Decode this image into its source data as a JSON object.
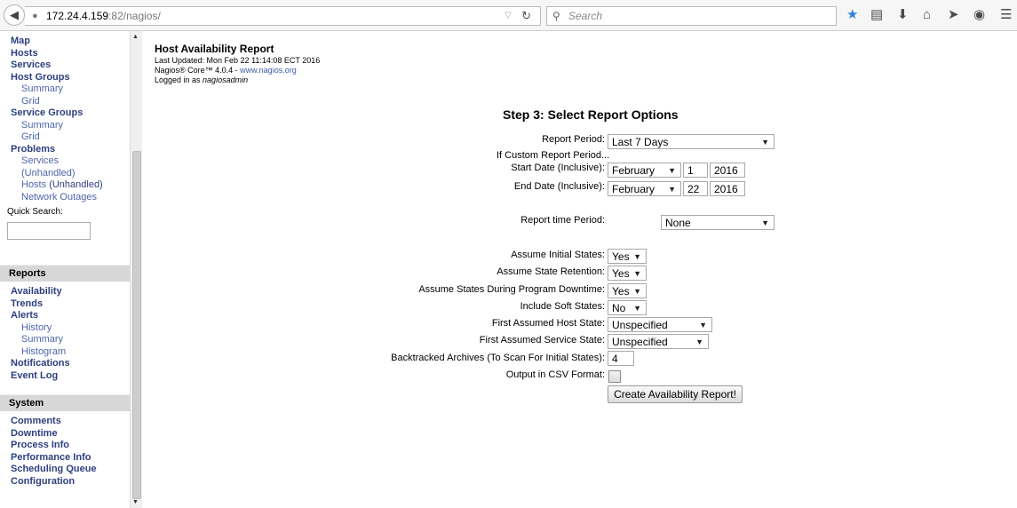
{
  "browser": {
    "url_host": "172.24.4.159",
    "url_rest": ":82/nagios/",
    "search_placeholder": "Search"
  },
  "sidebar": {
    "top_items": [
      {
        "label": "Map",
        "type": "item"
      },
      {
        "label": "Hosts",
        "type": "item"
      },
      {
        "label": "Services",
        "type": "item"
      },
      {
        "label": "Host Groups",
        "type": "item"
      },
      {
        "label": "Summary",
        "type": "sub"
      },
      {
        "label": "Grid",
        "type": "sub"
      },
      {
        "label": "Service Groups",
        "type": "item"
      },
      {
        "label": "Summary",
        "type": "sub"
      },
      {
        "label": "Grid",
        "type": "sub"
      },
      {
        "label": "Problems",
        "type": "item"
      },
      {
        "label": "Services",
        "type": "sub"
      },
      {
        "label": "(Unhandled)",
        "type": "sub"
      },
      {
        "label": "Hosts",
        "type": "sub"
      },
      {
        "label": "Network Outages",
        "type": "sub"
      }
    ],
    "hosts_unhandled": "(Unhandled)",
    "quick_search_label": "Quick Search:",
    "reports_header": "Reports",
    "reports_items": [
      {
        "label": "Availability",
        "type": "item"
      },
      {
        "label": "Trends",
        "type": "item"
      },
      {
        "label": "Alerts",
        "type": "item"
      },
      {
        "label": "History",
        "type": "sub"
      },
      {
        "label": "Summary",
        "type": "sub"
      },
      {
        "label": "Histogram",
        "type": "sub"
      },
      {
        "label": "Notifications",
        "type": "item"
      },
      {
        "label": "Event Log",
        "type": "item"
      }
    ],
    "system_header": "System",
    "system_items": [
      {
        "label": "Comments",
        "type": "item"
      },
      {
        "label": "Downtime",
        "type": "item"
      },
      {
        "label": "Process Info",
        "type": "item"
      },
      {
        "label": "Performance Info",
        "type": "item"
      },
      {
        "label": "Scheduling Queue",
        "type": "item"
      },
      {
        "label": "Configuration",
        "type": "item"
      }
    ]
  },
  "header": {
    "title": "Host Availability Report",
    "last_updated": "Last Updated: Mon Feb 22 11:14:08 ECT 2016",
    "version_prefix": "Nagios® Core™ 4.0.4 - ",
    "version_link": "www.nagios.org",
    "logged_prefix": "Logged in as ",
    "logged_user": "nagiosadmin"
  },
  "form": {
    "step_title": "Step 3: Select Report Options",
    "report_period_label": "Report Period:",
    "report_period_value": "Last 7 Days",
    "custom_period_label": "If Custom Report Period...",
    "start_date_label": "Start Date (Inclusive):",
    "start_month": "February",
    "start_day": "1",
    "start_year": "2016",
    "end_date_label": "End Date (Inclusive):",
    "end_month": "February",
    "end_day": "22",
    "end_year": "2016",
    "time_period_label": "Report time Period:",
    "time_period_value": "None",
    "initial_states_label": "Assume Initial States:",
    "initial_states_value": "Yes",
    "state_retention_label": "Assume State Retention:",
    "state_retention_value": "Yes",
    "downtime_label": "Assume States During Program Downtime:",
    "downtime_value": "Yes",
    "soft_states_label": "Include Soft States:",
    "soft_states_value": "No",
    "host_state_label": "First Assumed Host State:",
    "host_state_value": "Unspecified",
    "service_state_label": "First Assumed Service State:",
    "service_state_value": "Unspecified",
    "backtracked_label": "Backtracked Archives (To Scan For Initial States):",
    "backtracked_value": "4",
    "csv_label": "Output in CSV Format:",
    "csv_checked": false,
    "submit_label": "Create Availability Report!"
  }
}
